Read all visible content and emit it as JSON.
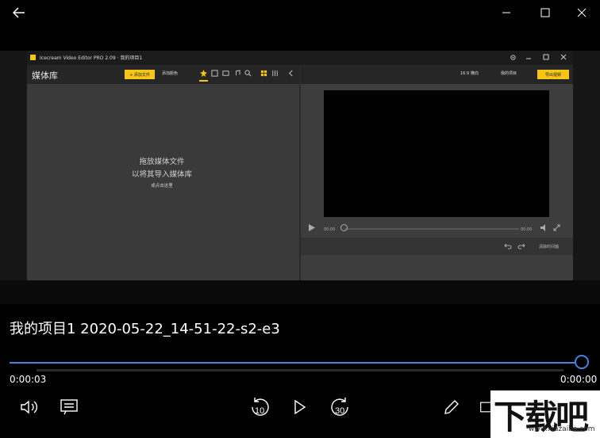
{
  "window": {
    "back_icon": "arrow-left-icon",
    "minimize_icon": "minimize-icon",
    "maximize_icon": "maximize-icon",
    "close_icon": "close-icon"
  },
  "embedded_app": {
    "title": "Icecream Video Editor PRO 2.09 · 我的项目1",
    "media_library_title": "媒体库",
    "add_file_label": "+ 添加文件",
    "add_color_label": "添加颜色",
    "drop_line1": "拖放媒体文件",
    "drop_line2": "以将其导入媒体库",
    "drop_line3": "或点击这里",
    "ratio_label": "16:9 横向",
    "my_project_label": "我的项目",
    "export_label": "导出视频",
    "current_time": "00:00",
    "total_time": "00:00",
    "clear_timeline_label": "清除时间轴"
  },
  "player": {
    "media_title": "我的项目1 2020-05-22_14-51-22-s2-e3",
    "elapsed": "0:00:03",
    "remaining": "0:00:00",
    "progress": 1.0,
    "skip_back_seconds": "10",
    "skip_forward_seconds": "30",
    "accent_color": "#4a80d8"
  },
  "watermark": {
    "big_text": "下载吧",
    "small_text": "www.xiazaiba.com"
  }
}
